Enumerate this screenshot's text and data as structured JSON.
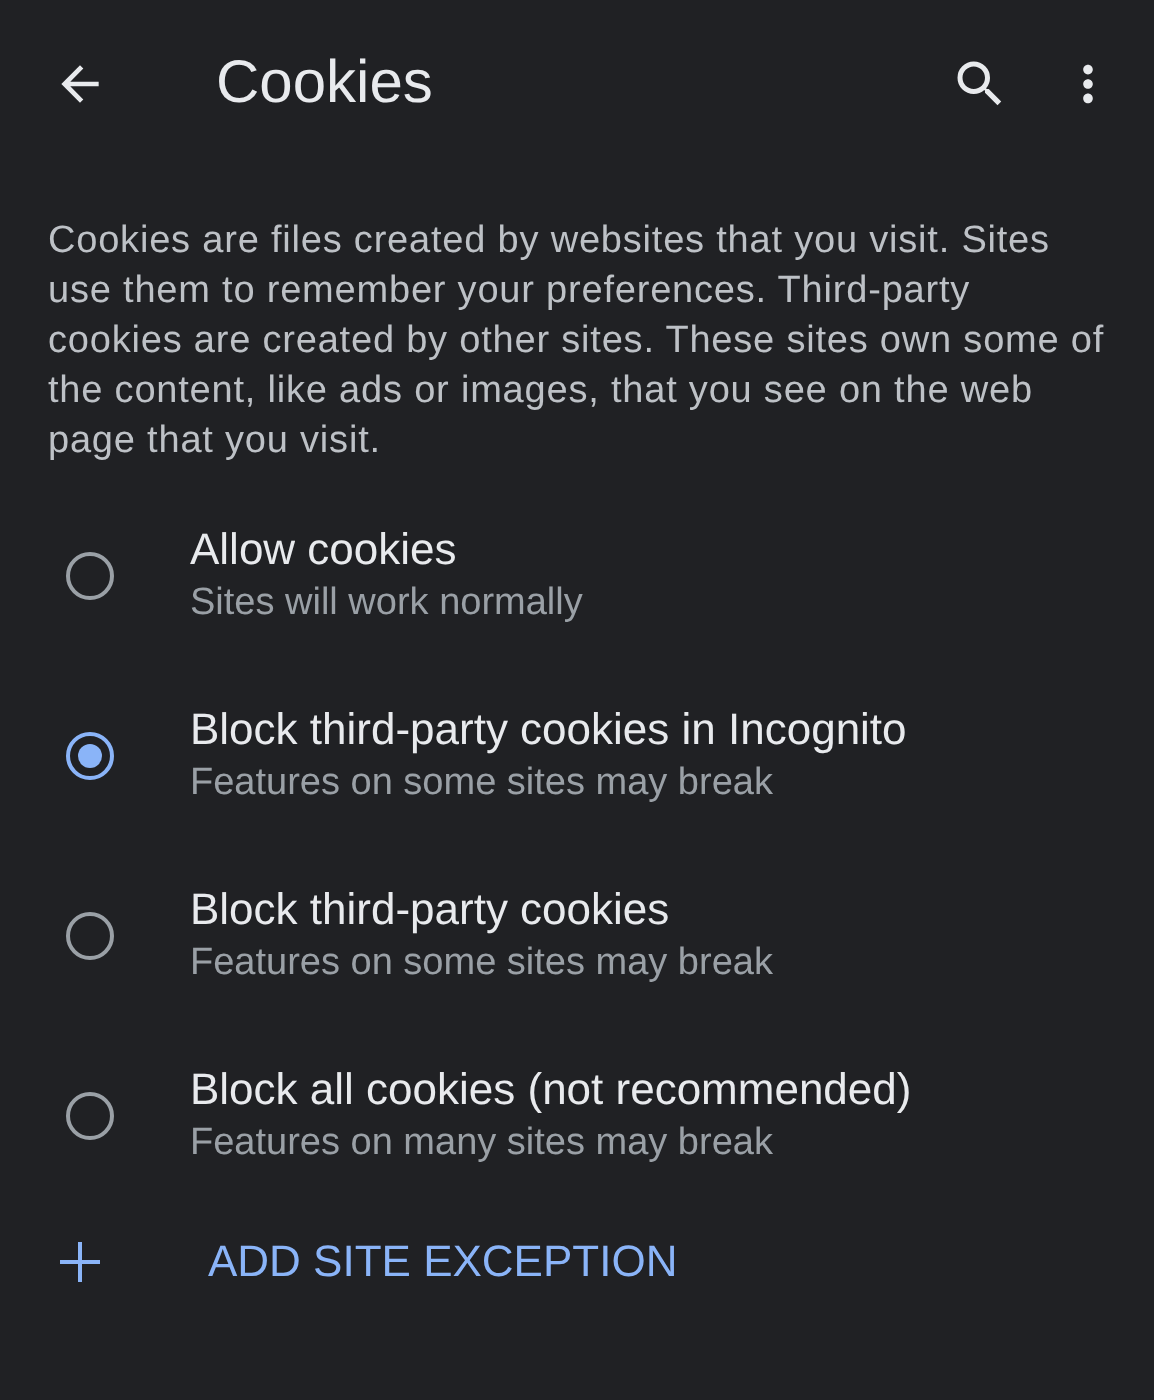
{
  "toolbar": {
    "title": "Cookies"
  },
  "description": "Cookies are files created by websites that you visit. Sites use them to remember your preferences. Third-party cookies are created by other sites. These sites own some of the content, like ads or images, that you see on the web page that you visit.",
  "options": [
    {
      "title": "Allow cookies",
      "subtitle": "Sites will work normally",
      "selected": false
    },
    {
      "title": "Block third-party cookies in Incognito",
      "subtitle": "Features on some sites may break",
      "selected": true
    },
    {
      "title": "Block third-party cookies",
      "subtitle": "Features on some sites may break",
      "selected": false
    },
    {
      "title": "Block all cookies (not recommended)",
      "subtitle": "Features on many sites may break",
      "selected": false
    }
  ],
  "add_exception": {
    "label": "ADD SITE EXCEPTION"
  }
}
